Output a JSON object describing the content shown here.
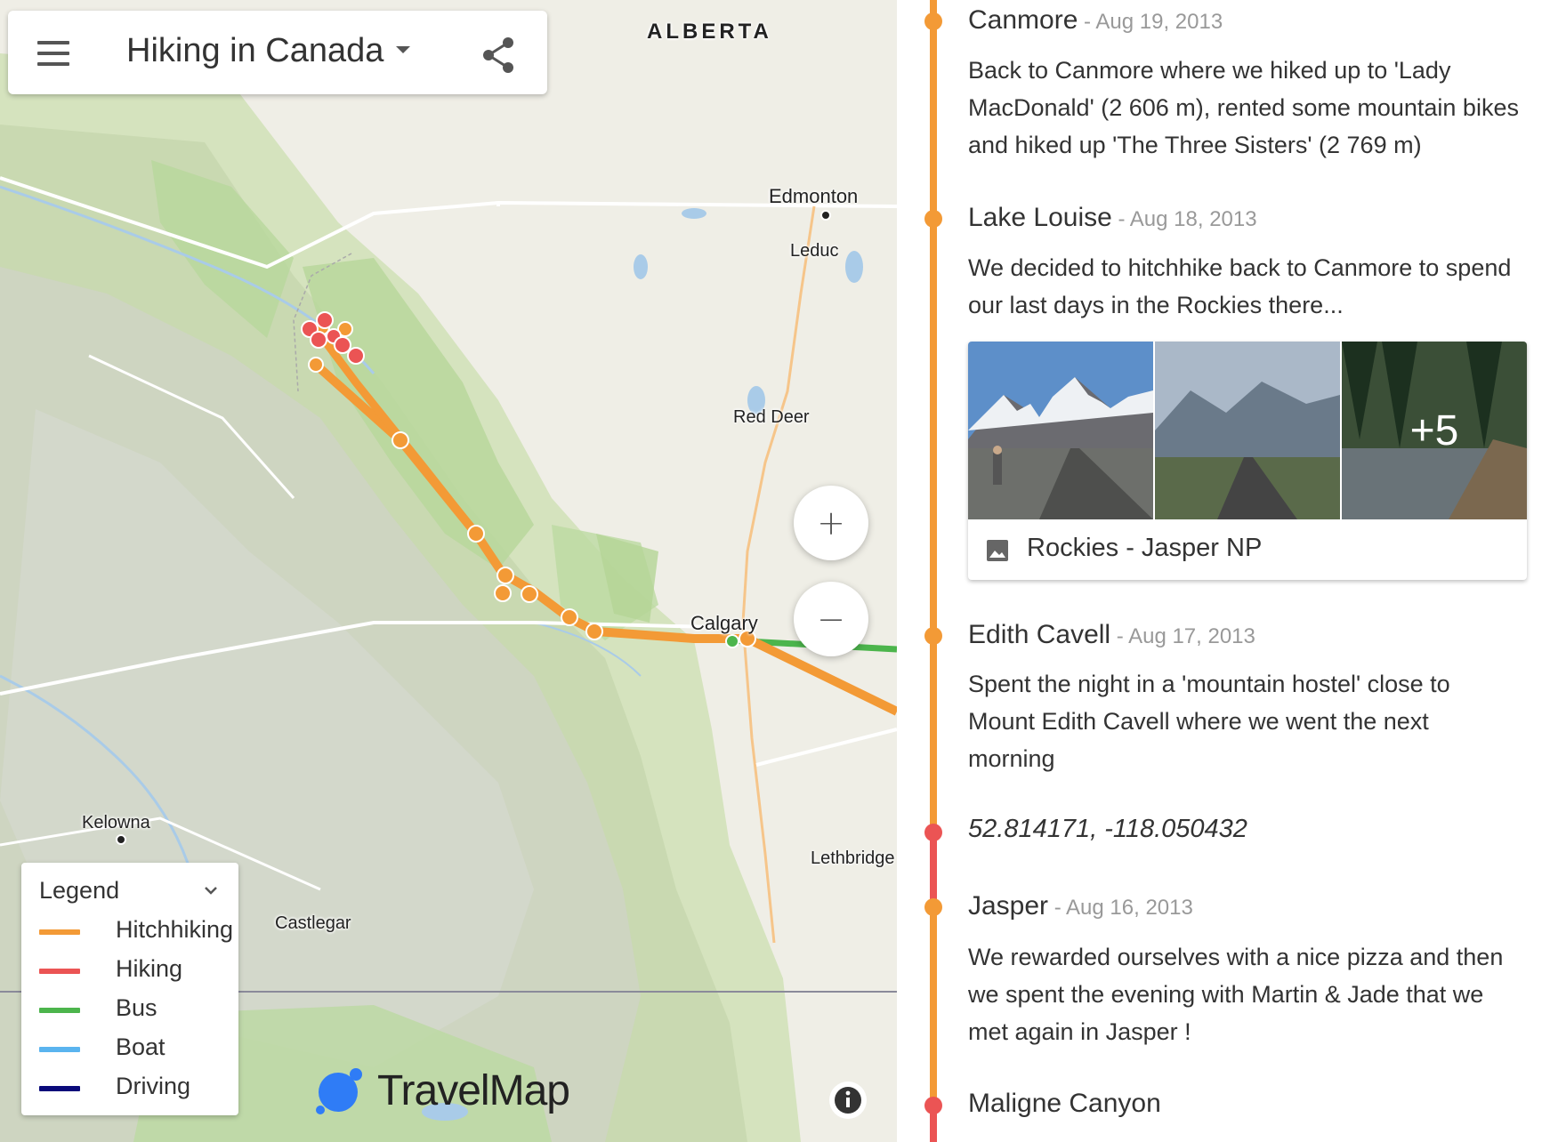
{
  "map": {
    "title": "Hiking in Canada",
    "region_label": "ALBERTA",
    "places": {
      "edmonton": "Edmonton",
      "leduc": "Leduc",
      "red_deer": "Red Deer",
      "calgary": "Calgary",
      "lethbridge": "Lethbridge",
      "kelowna": "Kelowna",
      "castlegar": "Castlegar"
    },
    "zoom_in": "+",
    "zoom_out": "−",
    "logo_text": "TravelMap",
    "icons": [
      "menu-icon",
      "share-icon",
      "info-icon",
      "chevron-down-icon"
    ]
  },
  "legend": {
    "title": "Legend",
    "items": [
      {
        "label": "Hitchhiking",
        "color": "#f39a36"
      },
      {
        "label": "Hiking",
        "color": "#eb5454"
      },
      {
        "label": "Bus",
        "color": "#4cb54c"
      },
      {
        "label": "Boat",
        "color": "#5ab4ef"
      },
      {
        "label": "Driving",
        "color": "#0a0a7a"
      }
    ]
  },
  "timeline": {
    "entries": [
      {
        "title": "Canmore",
        "date": " - Aug 19, 2013",
        "text": "Back to Canmore where we hiked up to 'Lady MacDonald' (2 606 m), rented some mountain bikes and hiked up 'The Three Sisters' (2 769 m)"
      },
      {
        "title": "Lake Louise",
        "date": " - Aug 18, 2013",
        "text": "We decided to hitchhike back to Canmore to spend our last days in the Rockies there..."
      },
      {
        "title": "Edith Cavell",
        "date": " - Aug 17, 2013",
        "text": "Spent the night in a 'mountain hostel' close to Mount Edith Cavell where we went the next morning"
      },
      {
        "title": "Jasper",
        "date": " - Aug 16, 2013",
        "text": "We rewarded ourselves with a nice pizza and then we spent the evening with Martin & Jade that we met again in Jasper !"
      },
      {
        "title": "Maligne Canyon",
        "date": "",
        "text": ""
      }
    ],
    "coordinates": "52.814171, -118.050432",
    "album": {
      "name": "Rockies - Jasper NP",
      "more_count": "+5"
    }
  },
  "colors": {
    "orange": "#f39a36",
    "red": "#eb5454",
    "green": "#4cb54c"
  }
}
